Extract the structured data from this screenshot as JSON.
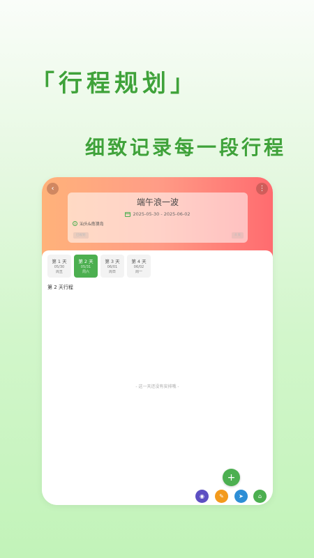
{
  "promo": {
    "title": "「行程规划」",
    "subtitle": "细致记录每一段行程"
  },
  "header": {
    "back_icon": "‹",
    "more_icon": "⋮",
    "trip_title": "端午浪一波",
    "date_range": "2025-05-30 - 2025-06-02",
    "location": "汕头&南澳岛",
    "tag_left": "已规划",
    "tag_right": "4 天"
  },
  "days": [
    {
      "name": "第 1 天",
      "date": "05/30",
      "week": "周五"
    },
    {
      "name": "第 2 天",
      "date": "05/31",
      "week": "周六"
    },
    {
      "name": "第 3 天",
      "date": "06/01",
      "week": "周日"
    },
    {
      "name": "第 4 天",
      "date": "06/02",
      "week": "周一"
    }
  ],
  "active_day_index": 1,
  "section": {
    "title": "第 2 天行程",
    "empty_text": "- 这一天还没有安排哦 -"
  },
  "fab": {
    "add_icon": "+"
  },
  "actions": [
    {
      "icon": "location-icon",
      "glyph": "◉",
      "color": "#5c4fc2"
    },
    {
      "icon": "ticket-icon",
      "glyph": "✎",
      "color": "#f39a1c"
    },
    {
      "icon": "transport-icon",
      "glyph": "➤",
      "color": "#2d8ed6"
    },
    {
      "icon": "hotel-icon",
      "glyph": "⌂",
      "color": "#4caf50"
    }
  ],
  "colors": {
    "accent": "#4caf50",
    "promo_text": "#3fa23a",
    "header_start": "#ffb27a",
    "header_end": "#ff6b6f"
  }
}
